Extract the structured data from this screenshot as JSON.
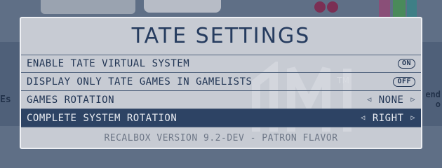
{
  "dialog": {
    "title": "TATE SETTINGS",
    "rows": [
      {
        "label": "ENABLE TATE VIRTUAL SYSTEM",
        "type": "toggle",
        "value": "ON"
      },
      {
        "label": "DISPLAY ONLY TATE GAMES IN GAMELISTS",
        "type": "toggle",
        "value": "OFF"
      },
      {
        "label": "GAMES ROTATION",
        "type": "selector",
        "value": "NONE"
      },
      {
        "label": "COMPLETE SYSTEM ROTATION",
        "type": "selector",
        "value": "RIGHT",
        "selected": true
      }
    ],
    "footer": "RECALBOX VERSION 9.2-DEV - PATRON FLAVOR"
  },
  "colors": {
    "dialog_bg": "#c7cbd3",
    "text": "#1f3352",
    "selected_row_bg": "#2d4364",
    "selected_row_text": "#e7eaf0",
    "footer_text": "#6f7888"
  },
  "background": {
    "left_fragment": "Es",
    "right_fragment_line1": "end",
    "right_fragment_line2": "o",
    "watermark_tm": "TM"
  }
}
